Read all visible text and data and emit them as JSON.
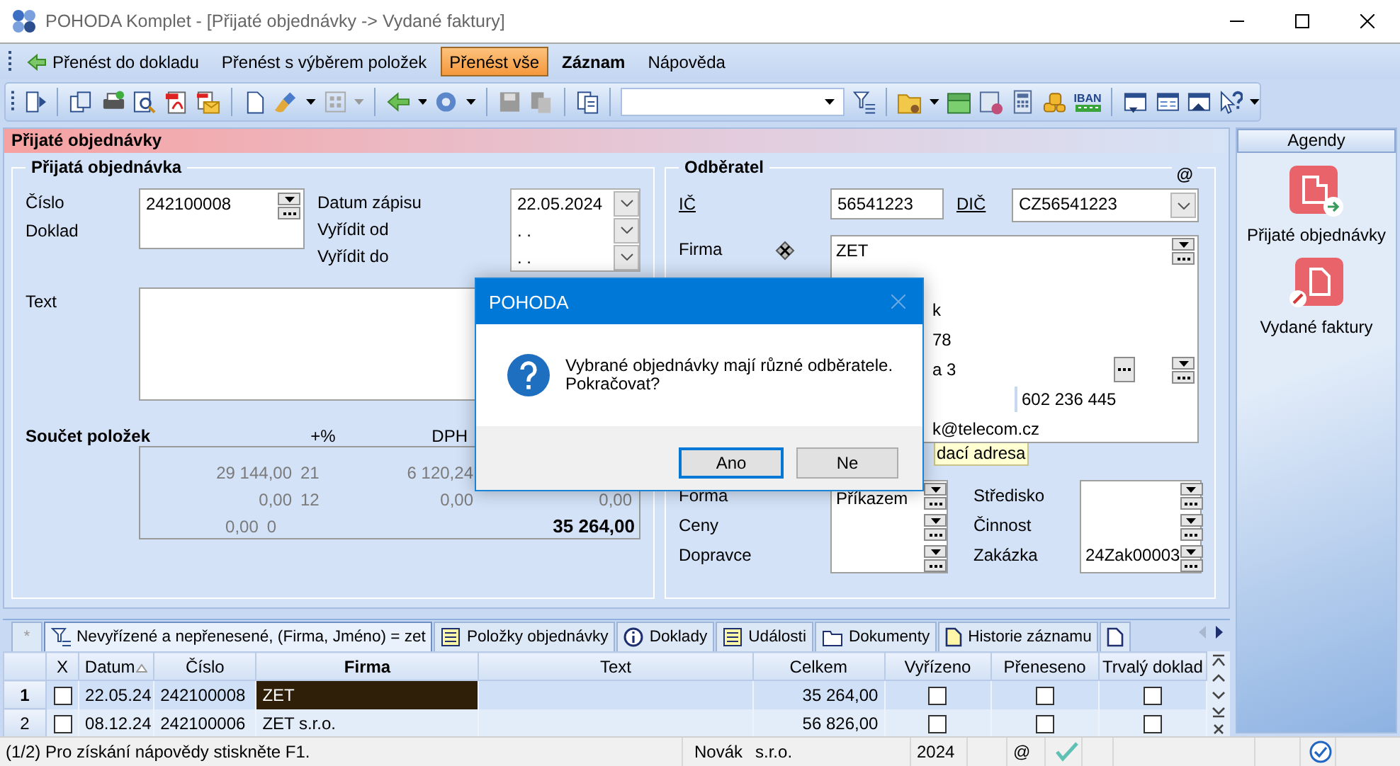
{
  "window": {
    "title": "POHODA Komplet - [Přijaté objednávky -> Vydané faktury]"
  },
  "menu": [
    {
      "label": "Přenést do dokladu",
      "kind": "transfer",
      "highlighted": false,
      "bold": false
    },
    {
      "label": "Přenést s výběrem položek",
      "kind": "plain",
      "highlighted": false,
      "bold": false
    },
    {
      "label": "Přenést vše",
      "kind": "plain",
      "highlighted": true,
      "bold": false
    },
    {
      "label": "Záznam",
      "kind": "plain",
      "highlighted": false,
      "bold": true
    },
    {
      "label": "Nápověda",
      "kind": "plain",
      "highlighted": false,
      "bold": false
    }
  ],
  "toolbar": {
    "iban": "IBAN"
  },
  "section": {
    "title": "Přijaté objednávky"
  },
  "order": {
    "legend": "Přijatá objednávka",
    "number_labels": [
      "Číslo",
      "Doklad"
    ],
    "number": "242100008",
    "dates": [
      {
        "label": "Datum zápisu",
        "value": "22.05.2024"
      },
      {
        "label": "Vyřídit od",
        "value": ". ."
      },
      {
        "label": "Vyřídit do",
        "value": ". ."
      }
    ],
    "text_label": "Text"
  },
  "totals": {
    "title": "Součet položek",
    "rate_header": "+%",
    "vat_header": "DPH",
    "rows": [
      {
        "base": "29 144,00",
        "rate": "21",
        "vat": "6 120,24"
      },
      {
        "base": "0,00",
        "rate": "12",
        "vat": "0,00",
        "total": "0,00"
      },
      {
        "base": "0,00",
        "rate": "0"
      }
    ],
    "grand_total": "35 264,00"
  },
  "customer": {
    "legend": "Odběratel",
    "email_mark": "@",
    "ic_label": "IČ",
    "ic": "56541223",
    "dic_label": "DIČ",
    "dic": "CZ56541223",
    "firma_label": "Firma",
    "firma_lines": [
      {
        "kind": "main",
        "text": "ZET"
      },
      {
        "kind": "cut",
        "text": "k"
      },
      {
        "kind": "cut",
        "text": "78"
      },
      {
        "kind": "cut_more",
        "text": "a 3"
      },
      {
        "kind": "phone",
        "text": "602 236 445"
      },
      {
        "kind": "cut",
        "text": "k@telecom.cz"
      }
    ],
    "delivery_tab": "dací adresa",
    "left_labels": [
      "Forma",
      "Ceny",
      "Dopravce"
    ],
    "left_values": [
      "Příkazem"
    ],
    "right_labels": [
      "Středisko",
      "Činnost",
      "Zakázka"
    ],
    "right_values": [
      "24Zak00003"
    ]
  },
  "dialog": {
    "title": "POHODA",
    "message": "Vybrané objednávky mají různé odběratele.\nPokračovat?",
    "buttons": [
      {
        "label": "Ano",
        "default": true
      },
      {
        "label": "Ne",
        "default": false
      }
    ]
  },
  "agenda": {
    "title": "Agendy",
    "items": [
      {
        "label": "Přijaté objednávky",
        "kind": "orders"
      },
      {
        "label": "Vydané faktury",
        "kind": "invoices"
      }
    ]
  },
  "tabs": [
    {
      "label": "*",
      "kind": "star",
      "selected": false
    },
    {
      "label": "Nevyřízené a nepřenesené, (Firma, Jméno) = zet",
      "kind": "filter",
      "selected": true
    },
    {
      "label": "Položky objednávky",
      "kind": "list",
      "selected": false
    },
    {
      "label": "Doklady",
      "kind": "info",
      "selected": false
    },
    {
      "label": "Události",
      "kind": "list",
      "selected": false
    },
    {
      "label": "Dokumenty",
      "kind": "folder",
      "selected": false
    },
    {
      "label": "Historie záznamu",
      "kind": "page",
      "selected": false
    },
    {
      "kind": "blank",
      "selected": false
    }
  ],
  "table": {
    "columns": [
      {
        "label": "X",
        "sorted": false,
        "bold": false
      },
      {
        "label": "Datum",
        "sorted": true,
        "bold": false
      },
      {
        "label": "Číslo",
        "sorted": false,
        "bold": false
      },
      {
        "label": "Firma",
        "sorted": false,
        "bold": true
      },
      {
        "label": "Text",
        "sorted": false,
        "bold": false
      },
      {
        "label": "Celkem",
        "sorted": false,
        "bold": false
      },
      {
        "label": "Vyřízeno",
        "sorted": false,
        "bold": false
      },
      {
        "label": "Přeneseno",
        "sorted": false,
        "bold": false
      },
      {
        "label": "Trvalý doklad",
        "sorted": false,
        "bold": false
      }
    ],
    "rows": [
      {
        "number": "1",
        "selected": true,
        "x": false,
        "date": "22.05.24",
        "doc": "242100008",
        "firma": "ZET",
        "total": "35 264,00",
        "done": false,
        "moved": false,
        "permanent": false
      },
      {
        "number": "2",
        "selected": false,
        "x": false,
        "date": "08.12.24",
        "doc": "242100006",
        "firma": "ZET s.r.o.",
        "total": "56 826,00",
        "done": false,
        "moved": false,
        "permanent": false
      }
    ]
  },
  "status_bar": {
    "help": "(1/2) Pro získání nápovědy stiskněte F1.",
    "user": "Novák",
    "company": "s.r.o.",
    "year": "2024",
    "mail": "@"
  }
}
